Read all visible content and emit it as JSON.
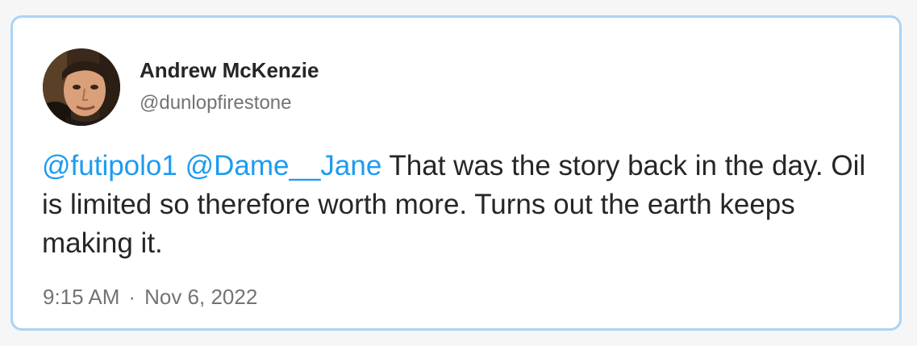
{
  "author": {
    "name": "Andrew McKenzie",
    "handle": "@dunlopfirestone"
  },
  "tweet": {
    "mentions": [
      "@futipolo1",
      "@Dame__Jane"
    ],
    "text": "That was the story back in the day. Oil is limited so therefore worth more. Turns out the earth keeps making it."
  },
  "meta": {
    "time": "9:15 AM",
    "separator": "·",
    "date": "Nov 6, 2022"
  },
  "colors": {
    "mention": "#1d9bf0",
    "border": "#a9d4f7",
    "text": "#262626",
    "muted": "#737373"
  }
}
